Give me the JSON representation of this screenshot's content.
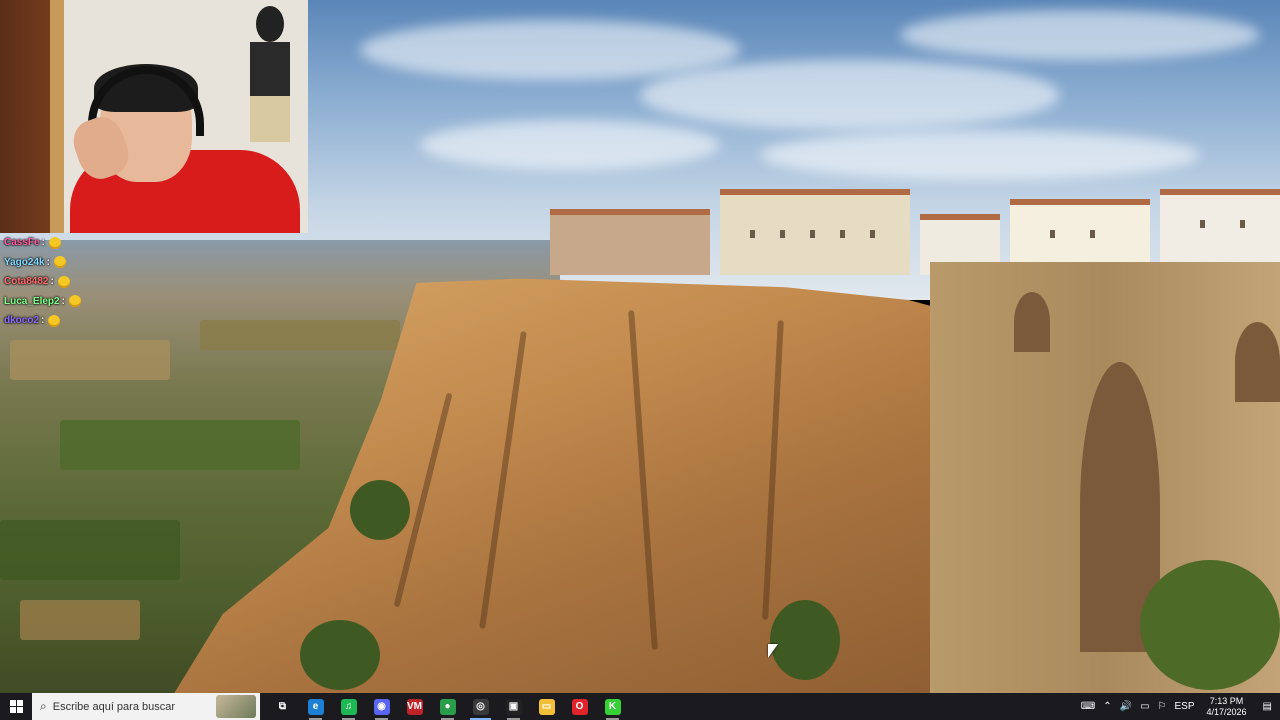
{
  "chat": {
    "messages": [
      {
        "user": "CassFe",
        "separator": ":",
        "color": "#ff5fa0"
      },
      {
        "user": "Yago24k",
        "separator": ":",
        "color": "#7fd8ff"
      },
      {
        "user": "Cota8482",
        "separator": ":",
        "color": "#ff6a6a"
      },
      {
        "user": "Luca_Elep2",
        "separator": ":",
        "color": "#7dff8a"
      },
      {
        "user": "dkoco2",
        "separator": ":",
        "color": "#8a6aff"
      }
    ]
  },
  "taskbar": {
    "search_placeholder": "Escribe aquí para buscar",
    "apps": [
      {
        "name": "task-view",
        "glyph": "⧉",
        "bg": "transparent"
      },
      {
        "name": "edge",
        "glyph": "e",
        "bg": "#1e7fd6"
      },
      {
        "name": "spotify",
        "glyph": "♫",
        "bg": "#1db954"
      },
      {
        "name": "discord",
        "glyph": "◉",
        "bg": "#5865f2"
      },
      {
        "name": "voicemeeter",
        "glyph": "VM",
        "bg": "#c0222a"
      },
      {
        "name": "chrome",
        "glyph": "●",
        "bg": "#2a9d4a"
      },
      {
        "name": "obs",
        "glyph": "◎",
        "bg": "#3a3a3a"
      },
      {
        "name": "steam-chat",
        "glyph": "▣",
        "bg": "#222"
      },
      {
        "name": "file-explorer",
        "glyph": "▭",
        "bg": "#f2c038"
      },
      {
        "name": "opera",
        "glyph": "O",
        "bg": "#e0242c"
      },
      {
        "name": "kick",
        "glyph": "K",
        "bg": "#36d134"
      }
    ],
    "tray": {
      "language": "ESP",
      "time": "7:13 PM",
      "date": "4/17/2026"
    }
  }
}
